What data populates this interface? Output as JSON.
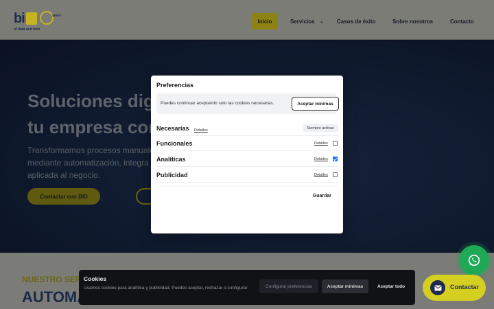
{
  "header": {
    "logo_text": "bi",
    "logo_tagline": "of data and tech",
    "logo_years": "years",
    "nav": [
      {
        "label": "Inicio"
      },
      {
        "label": "Servicios"
      },
      {
        "label": "Casos de éxito"
      },
      {
        "label": "Sobre nosotros"
      },
      {
        "label": "Contacto"
      }
    ]
  },
  "hero": {
    "title_line1": "Soluciones digi",
    "title_line2": "tu empresa con",
    "sub_line1": "Transformamos procesos manuale",
    "sub_line2": "mediante automatización, integra",
    "sub_line3": "aplicada al negocio.",
    "cta_label": "Contactar con BID"
  },
  "section": {
    "kicker": "NUESTRO SEF",
    "title": "AUTOMA"
  },
  "modal": {
    "title": "Preferencias",
    "notice": "Puedes continuar aceptando solo las cookies necesarias.",
    "accept_min_label": "Aceptar mínimas",
    "rows": [
      {
        "label": "Necesarias",
        "details": "Detalles",
        "badge": "Siempre activas"
      },
      {
        "label": "Funcionales",
        "details": "Detalles",
        "checked": false
      },
      {
        "label": "Analíticas",
        "details": "Detalles",
        "checked": true
      },
      {
        "label": "Publicidad",
        "details": "Detalles",
        "checked": false
      }
    ],
    "save_label": "Guardar"
  },
  "cookiebar": {
    "title": "Cookies",
    "text": "Usamos cookies para analítica y publicidad. Puedes aceptar, rechazar o configurar.",
    "configure_label": "Configurar preferencias",
    "accept_min_label": "Aceptar mínimas",
    "accept_all_label": "Aceptar todo"
  },
  "floating": {
    "contact_label": "Contactar"
  },
  "colors": {
    "accent": "#d5cf22",
    "brand_navy": "#1e2b4d",
    "whatsapp": "#1fa855",
    "checkbox_checked": "#1a73e8"
  }
}
